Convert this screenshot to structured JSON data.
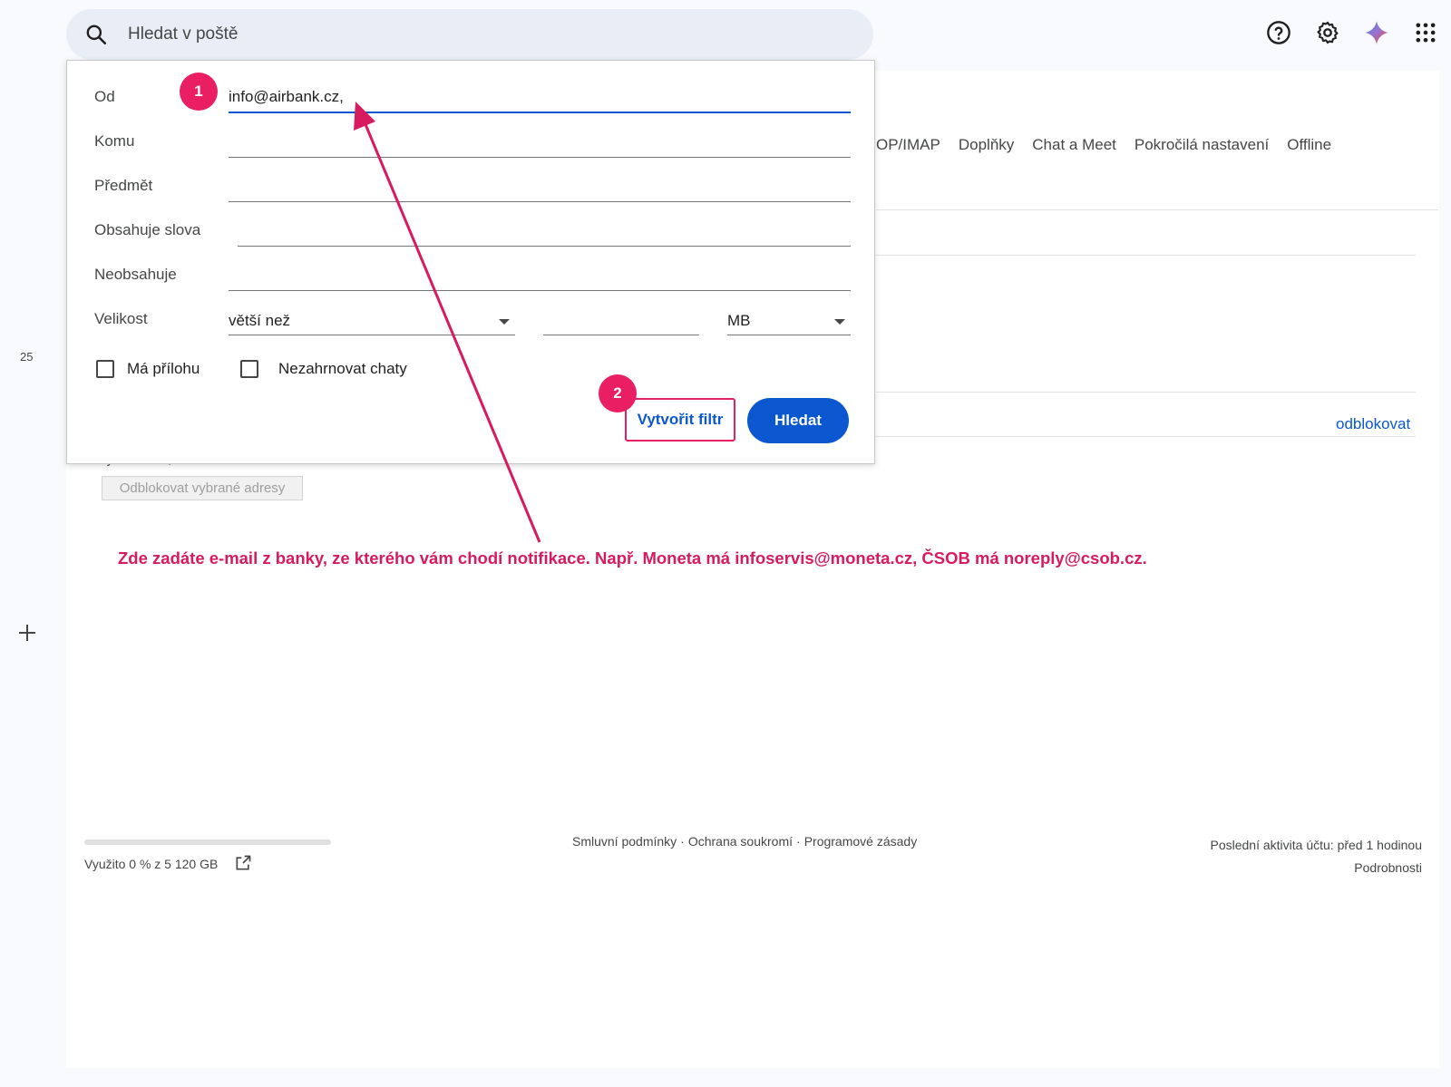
{
  "search": {
    "placeholder": "Hledat v poště"
  },
  "left_rail": {
    "count": "25"
  },
  "settings_tabs": [
    "OP/IMAP",
    "Doplňky",
    "Chat a Meet",
    "Pokročilá nastavení",
    "Offline"
  ],
  "blocked": {
    "unblock_link": "odblokovat",
    "select_label": "Vybrat: Vše, Nic",
    "unblock_selected_button": "Odblokovat vybrané adresy"
  },
  "filter": {
    "from_label": "Od",
    "from_value": "info@airbank.cz,",
    "to_label": "Komu",
    "subject_label": "Předmět",
    "has_words_label": "Obsahuje slova",
    "not_has_label": "Neobsahuje",
    "size_label": "Velikost",
    "size_comparator": "větší než",
    "size_unit": "MB",
    "has_attachment_label": "Má přílohu",
    "exclude_chats_label": "Nezahrnovat chaty",
    "create_filter_button": "Vytvořit filtr",
    "search_button": "Hledat"
  },
  "annotation": {
    "badge_1": "1",
    "badge_2": "2",
    "text": "Zde zadáte e-mail z banky, ze kterého vám chodí notifikace. Např. Moneta má infoservis@moneta.cz, ČSOB má noreply@csob.cz.",
    "color": "#d81b60"
  },
  "footer": {
    "storage_text": "Využito 0 % z 5 120 GB",
    "storage_percent": 0,
    "links": [
      "Smluvní podmínky",
      "·",
      "Ochrana soukromí",
      "·",
      "Programové zásady"
    ],
    "last_activity": "Poslední aktivita účtu: před 1 hodinou",
    "details": "Podrobnosti"
  },
  "colors": {
    "accent": "#0b57d0",
    "highlight": "#e91e63"
  }
}
